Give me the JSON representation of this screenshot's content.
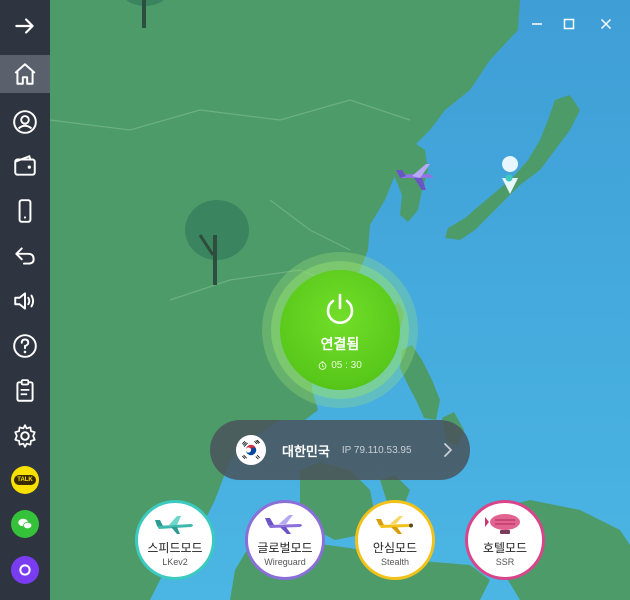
{
  "sidebar": {
    "items": [
      {
        "name": "expand",
        "icon": "arrow-right-icon"
      },
      {
        "name": "home",
        "icon": "home-icon"
      },
      {
        "name": "account",
        "icon": "user-icon"
      },
      {
        "name": "wallet",
        "icon": "wallet-icon"
      },
      {
        "name": "devices",
        "icon": "phone-icon"
      },
      {
        "name": "back",
        "icon": "undo-icon"
      },
      {
        "name": "sound",
        "icon": "speaker-icon"
      },
      {
        "name": "help",
        "icon": "question-icon"
      },
      {
        "name": "notes",
        "icon": "clipboard-icon"
      },
      {
        "name": "settings",
        "icon": "gear-icon"
      },
      {
        "name": "kakaotalk",
        "icon": "kakaotalk-icon",
        "label": "TALK",
        "color": "#f8e000"
      },
      {
        "name": "wechat",
        "icon": "wechat-icon",
        "color": "#35c23a"
      },
      {
        "name": "other",
        "icon": "circle-app-icon",
        "color": "#7a3cf0"
      }
    ],
    "active": "home"
  },
  "window": {
    "controls": [
      "minimize-icon",
      "maximize-icon",
      "close-icon"
    ]
  },
  "connection": {
    "status": "연결됨",
    "timer": "05 : 30",
    "accent": "#5bcc1c"
  },
  "location": {
    "country": "대한민국",
    "ip": "IP 79.110.53.95",
    "flag": "south-korea-flag-icon"
  },
  "modes": [
    {
      "id": "speed",
      "name": "스피드모드",
      "sub": "LKev2",
      "color": "#3cc9c0",
      "icon": "jet-plane-icon"
    },
    {
      "id": "global",
      "name": "글로벌모드",
      "sub": "Wireguard",
      "color": "#8a6fd8",
      "icon": "purple-plane-icon"
    },
    {
      "id": "safe",
      "name": "안심모드",
      "sub": "Stealth",
      "color": "#f2c21b",
      "icon": "yellow-plane-icon"
    },
    {
      "id": "hotel",
      "name": "호텔모드",
      "sub": "SSR",
      "color": "#d8458a",
      "icon": "blimp-icon"
    }
  ]
}
